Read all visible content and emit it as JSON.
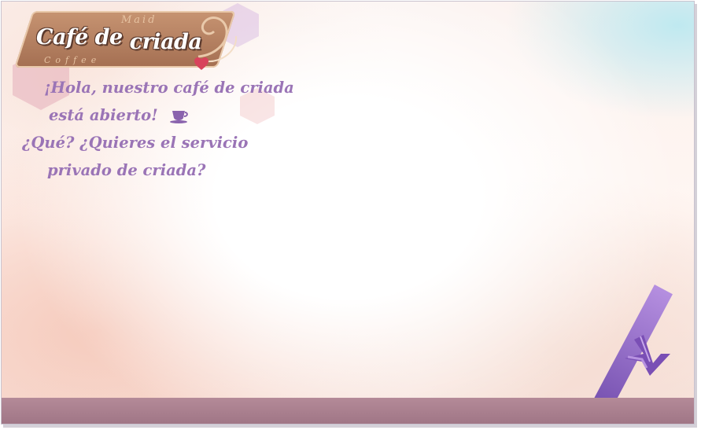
{
  "logo": {
    "title_line1": "Café de",
    "title_line2": "criada",
    "tag_top": "Maid",
    "tag_bottom": "Coffee"
  },
  "dialogue": {
    "lines": [
      "¡Hola, nuestro café de criada",
      "está abierto!",
      "¿Qué? ¿Quieres el servicio",
      "privado de criada?"
    ],
    "inline_icon": "coffee-cup-icon"
  },
  "colors": {
    "dialogue_text": "#9a74b6",
    "accent_purple": "#7a4fb5",
    "bottom_bar": "#a88090",
    "logo_brown": "#a46f52"
  },
  "icons": {
    "advance": "advance-arrow-icon",
    "heart": "heart-icon"
  }
}
